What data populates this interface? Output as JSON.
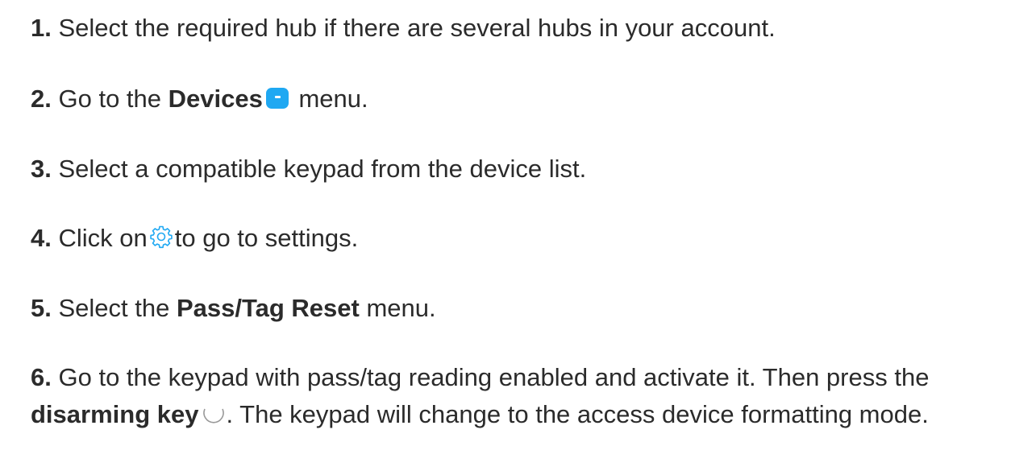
{
  "steps": [
    {
      "num": "1.",
      "text": "Select the required hub if there are several hubs in your account."
    },
    {
      "num": "2.",
      "pre": "Go to the",
      "bold": "Devices",
      "post": "menu.",
      "icon": "devices-icon"
    },
    {
      "num": "3.",
      "text": "Select a compatible keypad from the device list."
    },
    {
      "num": "4.",
      "pre": "Click on",
      "post": "to go to settings.",
      "icon": "gear-icon"
    },
    {
      "num": "5.",
      "pre": "Select the",
      "bold": "Pass/Tag Reset",
      "post": "menu."
    },
    {
      "num": "6.",
      "pre": "Go to the keypad with pass/tag reading enabled and activate it. Then press the",
      "bold": "disarming key",
      "post": ". The keypad will change to the access device formatting mode.",
      "icon": "disarm-key-icon"
    }
  ],
  "colors": {
    "text": "#2b2b2b",
    "accent": "#1fa8f2"
  }
}
